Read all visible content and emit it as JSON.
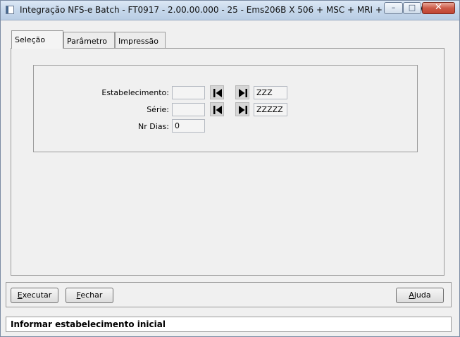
{
  "window": {
    "title": "Integração NFS-e Batch - FT0917 - 2.00.00.000 - 25 - Ems206B X 506 + MSC + MRI + MLF + W...",
    "min_glyph": "–",
    "max_glyph": "□",
    "close_glyph": "✕"
  },
  "tabs": [
    {
      "label": "Seleção",
      "active": true
    },
    {
      "label": "Parâmetro",
      "active": false
    },
    {
      "label": "Impressão",
      "active": false
    }
  ],
  "form": {
    "estabelecimento": {
      "label": "Estabelecimento:",
      "from_value": "",
      "to_value": "ZZZ"
    },
    "serie": {
      "label": "Série:",
      "from_value": "",
      "to_value": "ZZZZZ"
    },
    "nr_dias": {
      "label": "Nr Dias:",
      "value": "0"
    }
  },
  "buttons": {
    "executar": {
      "first": "E",
      "rest": "xecutar"
    },
    "fechar": {
      "first": "F",
      "rest": "echar"
    },
    "ajuda": {
      "first": "A",
      "rest": "juda"
    }
  },
  "status": {
    "text": "Informar estabelecimento inicial"
  },
  "icons": {
    "first": "skip-first-icon",
    "last": "skip-last-icon"
  }
}
